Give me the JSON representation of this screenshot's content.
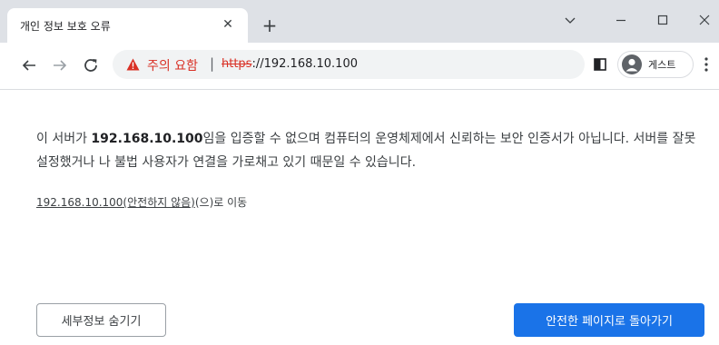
{
  "tab": {
    "title": "개인 정보 보호 오류",
    "close_glyph": "✕",
    "new_tab_glyph": "+"
  },
  "window_controls": {
    "icons": [
      "chevron-down-icon",
      "minimize-icon",
      "maximize-icon",
      "close-icon"
    ]
  },
  "toolbar": {
    "back_icon": "back-arrow-icon",
    "forward_icon": "forward-arrow-icon",
    "reload_icon": "reload-icon"
  },
  "omnibox": {
    "security_text": "주의 요함",
    "separator": "|",
    "url_scheme": "https",
    "url_rest": "://192.168.10.100",
    "warn_color": "#d93025"
  },
  "profile": {
    "label": "게스트"
  },
  "page": {
    "msg_prefix": "이 서버가 ",
    "msg_host": "192.168.10.100",
    "msg_suffix": "임을 입증할 수 없으며 컴퓨터의 운영체제에서 신뢰하는 보안 인증서가 아닙니다. 서버를 잘못 설정했거나 나 불법 사용자가 연결을 가로채고 있기 때문일 수 있습니다.",
    "proceed_link": "192.168.10.100(안전하지 않음)",
    "proceed_suffix": "(으)로 이동"
  },
  "buttons": {
    "hide_details": "세부정보 숨기기",
    "back_to_safety": "안전한 페이지로 돌아가기",
    "primary_color": "#1a73e8"
  }
}
